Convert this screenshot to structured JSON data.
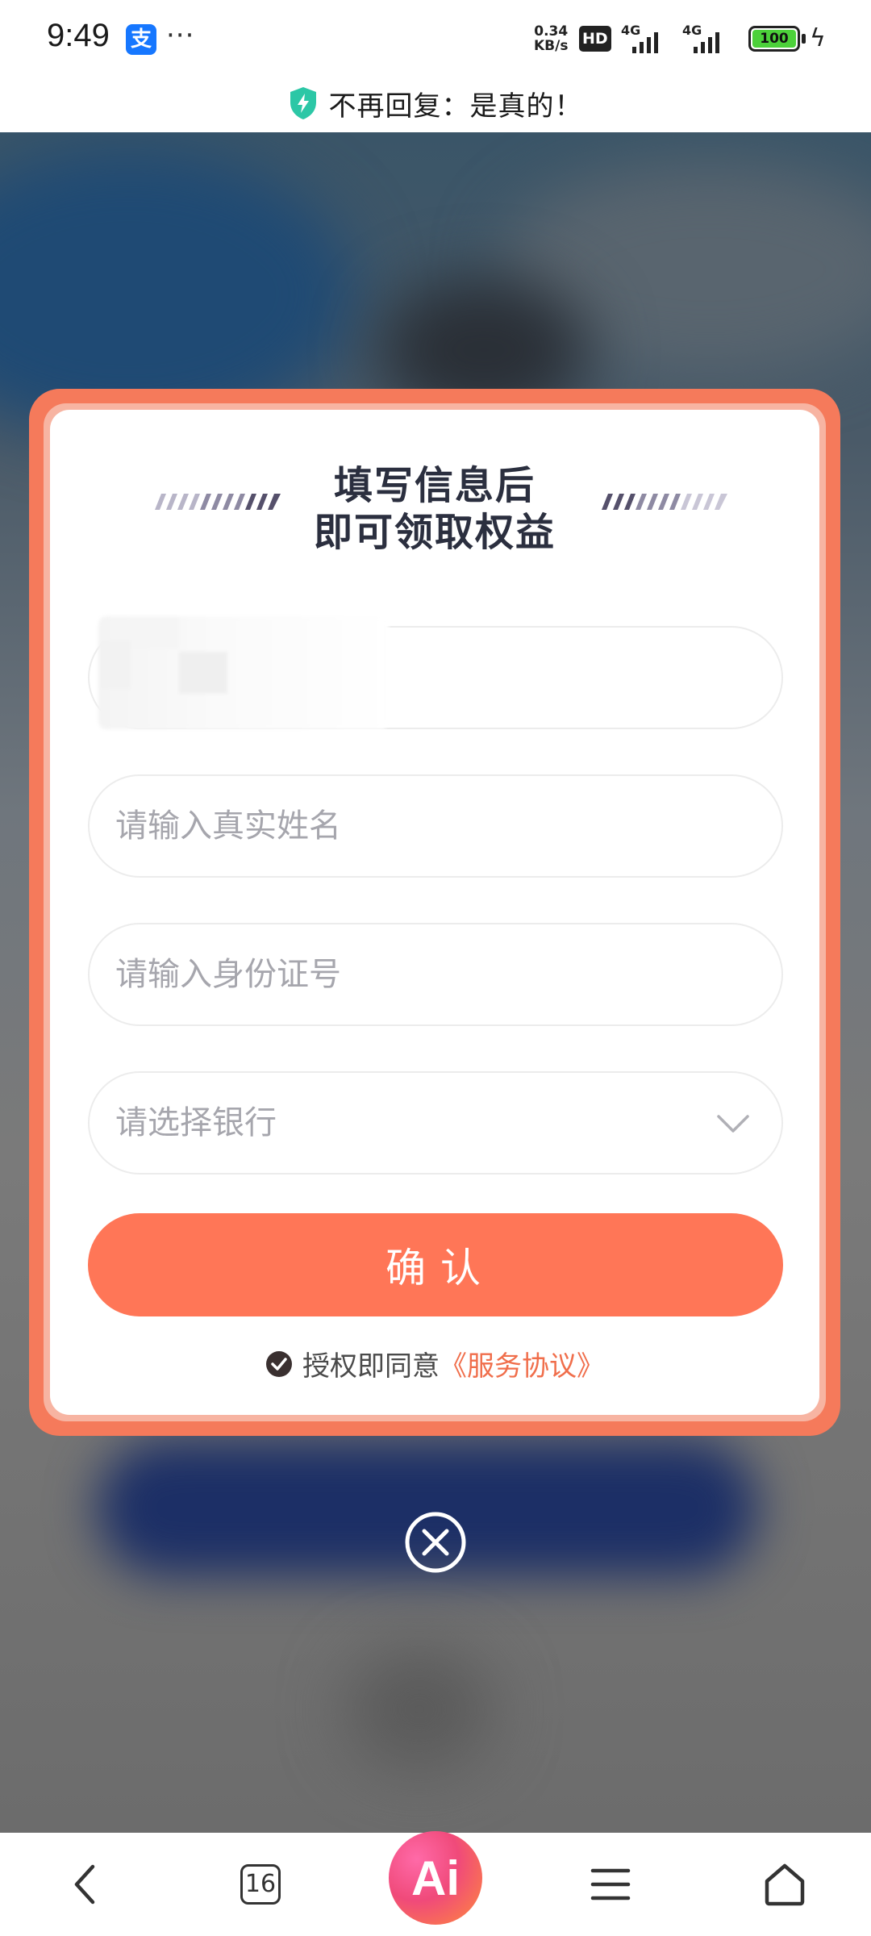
{
  "status_bar": {
    "time": "9:49",
    "alipay_glyph": "支",
    "more": "···",
    "net_speed_value": "0.34",
    "net_speed_unit": "KB/s",
    "hd": "HD",
    "sim1": "4G",
    "sim2": "4G",
    "battery": "100"
  },
  "secure_notice": {
    "text": "不再回复：是真的！"
  },
  "dialog": {
    "title_line1": "填写信息后",
    "title_line2": "即可领取权益",
    "name_placeholder": "请输入真实姓名",
    "id_placeholder": "请输入身份证号",
    "bank_placeholder": "请选择银行",
    "confirm_label": "确认",
    "agree_text": "授权即同意",
    "agree_link": "《服务协议》"
  },
  "bottom_nav": {
    "tab_count": "16",
    "ai_label": "Ai"
  },
  "colors": {
    "accent": "#ff7657",
    "frame": "#f57a5b",
    "title": "#2b2f3f",
    "link": "#f06e4b"
  },
  "icons": [
    "alipay-icon",
    "shield-icon",
    "chevron-down-icon",
    "check-circle-icon",
    "close-icon",
    "back-icon",
    "tabs-icon",
    "ai-icon",
    "menu-icon",
    "home-icon"
  ]
}
